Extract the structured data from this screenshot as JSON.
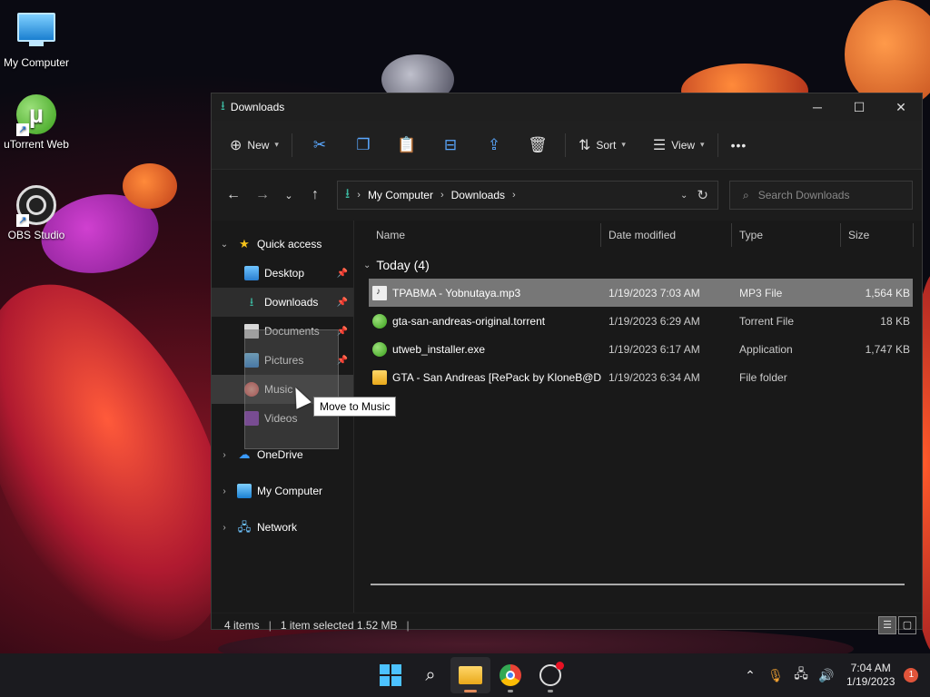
{
  "desktop": {
    "icons": [
      {
        "label": "My Computer"
      },
      {
        "label": "uTorrent Web"
      },
      {
        "label": "OBS Studio"
      }
    ]
  },
  "window": {
    "title": "Downloads",
    "controls": {
      "minimize": "─",
      "maximize": "☐",
      "close": "✕"
    }
  },
  "toolbar": {
    "new_label": "New",
    "sort_label": "Sort",
    "view_label": "View",
    "more_label": "•••"
  },
  "address": {
    "crumbs": [
      "My Computer",
      "Downloads"
    ],
    "search_placeholder": "Search Downloads"
  },
  "sidebar": {
    "quick_access": "Quick access",
    "items": [
      {
        "label": "Desktop"
      },
      {
        "label": "Downloads"
      },
      {
        "label": "Documents"
      },
      {
        "label": "Pictures"
      },
      {
        "label": "Music"
      },
      {
        "label": "Videos"
      }
    ],
    "roots": [
      {
        "label": "OneDrive"
      },
      {
        "label": "My Computer"
      },
      {
        "label": "Network"
      }
    ]
  },
  "columns": {
    "name": "Name",
    "date": "Date modified",
    "type": "Type",
    "size": "Size"
  },
  "group": {
    "label": "Today (4)"
  },
  "files": [
    {
      "name": "TPABMA - Yobnutaya.mp3",
      "date": "1/19/2023 7:03 AM",
      "type": "MP3 File",
      "size": "1,564 KB"
    },
    {
      "name": "gta-san-andreas-original.torrent",
      "date": "1/19/2023 6:29 AM",
      "type": "Torrent File",
      "size": "18 KB"
    },
    {
      "name": "utweb_installer.exe",
      "date": "1/19/2023 6:17 AM",
      "type": "Application",
      "size": "1,747 KB"
    },
    {
      "name": "GTA - San Andreas [RePack by KloneB@D...",
      "date": "1/19/2023 6:34 AM",
      "type": "File folder",
      "size": ""
    }
  ],
  "status": {
    "items": "4 items",
    "selected": "1 item selected  1.52 MB"
  },
  "tooltip": {
    "text": "Move to Music"
  },
  "taskbar": {
    "time": "7:04 AM",
    "date": "1/19/2023",
    "notifications": "1"
  }
}
